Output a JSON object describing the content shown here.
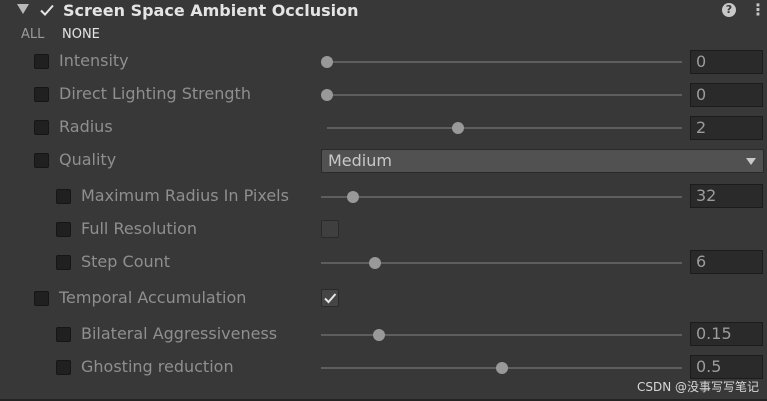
{
  "header": {
    "title": "Screen Space Ambient Occlusion",
    "enabled": true,
    "help_icon": "?",
    "menu_icon": "⋮"
  },
  "override_links": {
    "all": "ALL",
    "none": "NONE"
  },
  "rows": {
    "intensity": {
      "label": "Intensity",
      "value": "0",
      "slider": 0.0
    },
    "direct_lighting": {
      "label": "Direct Lighting Strength",
      "value": "0",
      "slider": 0.0
    },
    "radius": {
      "label": "Radius",
      "value": "2",
      "slider": 0.37
    },
    "quality": {
      "label": "Quality",
      "value": "Medium"
    },
    "max_radius": {
      "label": "Maximum Radius In Pixels",
      "value": "32",
      "slider": 0.09
    },
    "full_resolution": {
      "label": "Full Resolution",
      "checked": false
    },
    "step_count": {
      "label": "Step Count",
      "value": "6",
      "slider": 0.15
    },
    "temporal": {
      "label": "Temporal Accumulation",
      "checked": true
    },
    "bilateral": {
      "label": "Bilateral Aggressiveness",
      "value": "0.15",
      "slider": 0.16
    },
    "ghosting": {
      "label": "Ghosting reduction",
      "value": "0.5",
      "slider": 0.5
    }
  },
  "watermark": "CSDN @没事写写笔记"
}
